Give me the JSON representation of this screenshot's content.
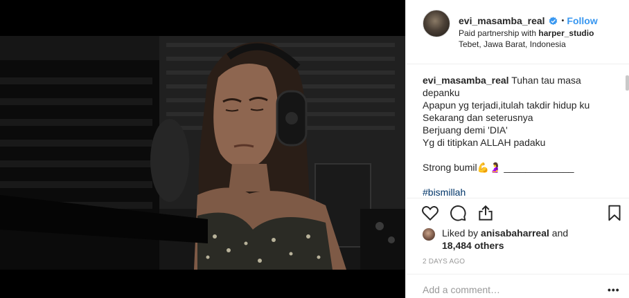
{
  "post": {
    "username": "evi_masamba_real",
    "follow_label": "Follow",
    "separator": "•",
    "partnership_prefix": "Paid partnership with",
    "partner_name": "harper_studio",
    "location": "Tebet, Jawa Barat, Indonesia"
  },
  "caption": {
    "username": "evi_masamba_real",
    "first_text": "Tuhan tau masa",
    "lines": [
      "depanku",
      "Apapun yg terjadi,itulah takdir hidup ku",
      "Sekarang dan seterusnya",
      "Berjuang demi 'DIA'",
      "Yg di titipkan ALLAH padaku"
    ],
    "strong_line": "Strong bumil💪🤰 _____________",
    "hashtag": "#bismillah"
  },
  "likes": {
    "prefix": "Liked by",
    "liker": "anisabaharreal",
    "connector": "and",
    "others": "18,484 others"
  },
  "timestamp": "2 DAYS AGO",
  "comment": {
    "placeholder": "Add a comment…",
    "more_label": "•••"
  },
  "colors": {
    "accent": "#3897f0",
    "text": "#262626",
    "muted": "#999999",
    "hashtag": "#003569"
  },
  "icons": [
    "verified-badge-icon",
    "heart-icon",
    "comment-icon",
    "share-icon",
    "bookmark-icon"
  ]
}
